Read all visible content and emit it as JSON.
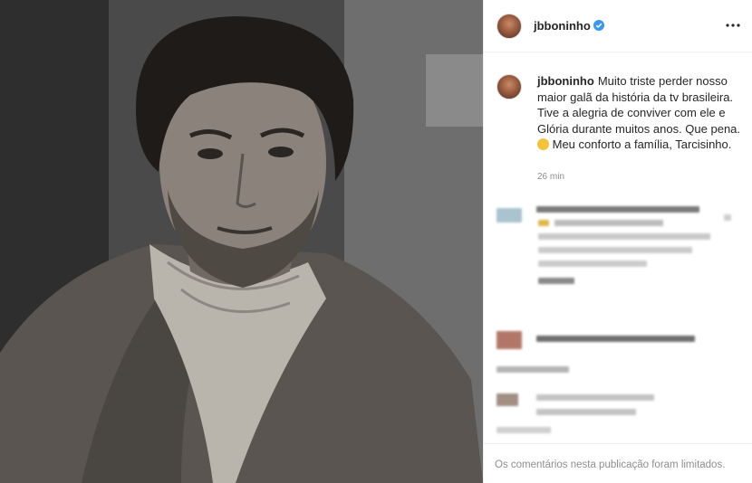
{
  "post": {
    "image_alt": "Black and white portrait of a man with dark hair, beard and a patterned scarf"
  },
  "header": {
    "username": "jbboninho",
    "verified_icon": "verified-badge-icon",
    "more_icon": "more-options-icon"
  },
  "caption": {
    "username": "jbboninho",
    "text_before_emoji": "Muito triste perder nosso maior galã da história da tv brasileira. Tive a alegria de conviver com ele e Glória durante muitos anos. Que pena.",
    "emoji": "sad-face-emoji",
    "text_after_emoji": "Meu conforto a família, Tarcisinho.",
    "timestamp": "26 min"
  },
  "footer": {
    "limited_comments": "Os comentários nesta publicação foram limitados."
  },
  "colors": {
    "verified_blue": "#3897f0",
    "muted_text": "#8e8e8e",
    "border": "#efefef"
  }
}
